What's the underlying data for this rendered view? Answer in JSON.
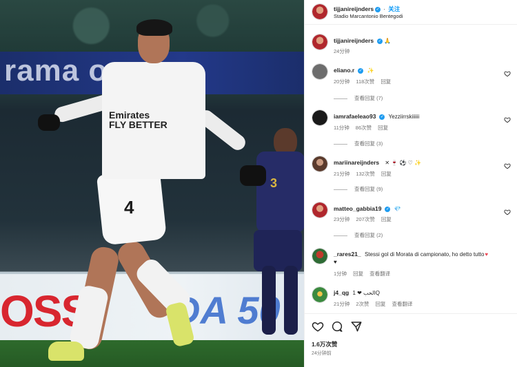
{
  "photo": {
    "ad_top_text": "rama   oma",
    "ad_bottom_text": "OSS",
    "ad_bottom_text2": "DA 50",
    "sponsor": "Emirates\nFLY BETTER",
    "shirt_number": "4",
    "opponent_number": "3"
  },
  "header": {
    "username": "tijjanireijnders",
    "follow_label": "关注",
    "location": "Stadio Marcantonio Bentegodi"
  },
  "caption": {
    "username": "tijjanireijnders",
    "emoji": "🙏",
    "time": "24分钟"
  },
  "comments": [
    {
      "username": "eliano.r",
      "text": "✨",
      "time": "20分钟",
      "likes": "118次赞",
      "reply": "回复",
      "view_replies": "查看回复 (7)",
      "avatar_color": "#6d6d6d"
    },
    {
      "username": "iamrafaeleao93",
      "text": "Yezziirrskiiiiii",
      "time": "11分钟",
      "likes": "86次赞",
      "reply": "回复",
      "view_replies": "查看回复 (3)",
      "avatar_color": "#1a1a1a"
    },
    {
      "username": "mariinareijnders",
      "text": "✕ 🍷 ⚽ ♡ ✨",
      "time": "21分钟",
      "likes": "132次赞",
      "reply": "回复",
      "view_replies": "查看回复 (9)",
      "avatar_color": "#5a3a2c"
    },
    {
      "username": "matteo_gabbia19",
      "text": "💎",
      "time": "23分钟",
      "likes": "207次赞",
      "reply": "回复",
      "view_replies": "查看回复 (2)",
      "avatar_color": "#b0272d"
    },
    {
      "username": "_rares21_",
      "text": "Stessi gol di Morata di campionato, ho detto tutto",
      "text2": "♥",
      "time": "1分钟",
      "likes": "",
      "reply": "回复",
      "translate": "查看翻译",
      "avatar_color": "#2e6b35"
    },
    {
      "username": "j4_qg",
      "text": "الحب ❤ 1Q",
      "time": "21分钟",
      "likes": "2次赞",
      "reply": "回复",
      "translate": "查看翻译",
      "avatar_color": "#3b8a3f"
    }
  ],
  "footer": {
    "likes": "1.6万次赞",
    "time_ago": "24分钟前"
  },
  "colors": {
    "accent": "#0095f6",
    "verified": "#1f9cf0",
    "heart_red": "#ed4956"
  }
}
